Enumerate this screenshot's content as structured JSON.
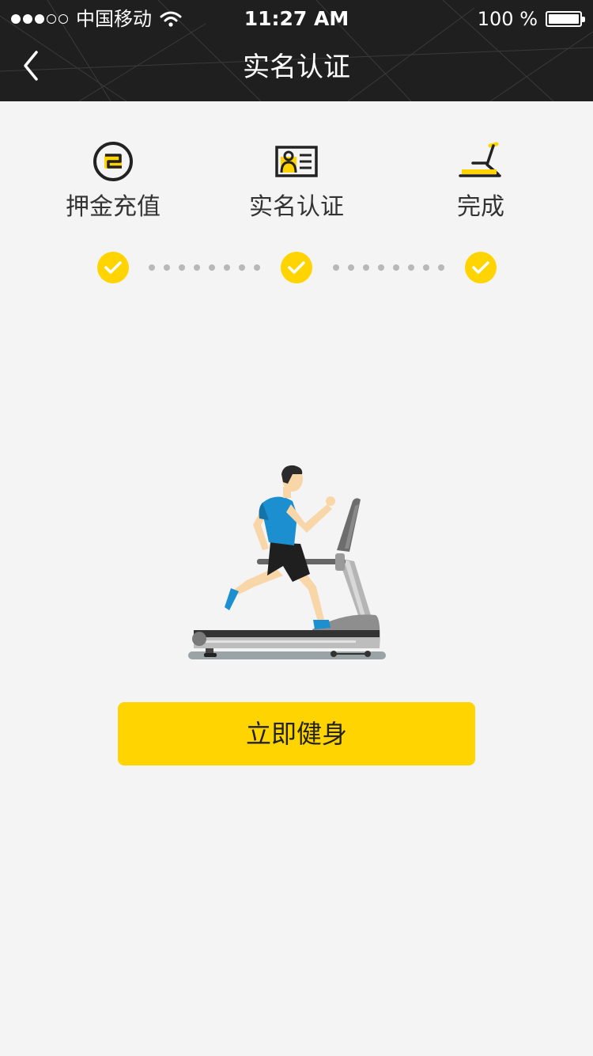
{
  "status_bar": {
    "carrier": "中国移动",
    "time": "11:27 AM",
    "battery": "100 %"
  },
  "nav": {
    "title": "实名认证"
  },
  "steps": [
    {
      "label": "押金充值",
      "icon": "deposit-icon"
    },
    {
      "label": "实名认证",
      "icon": "id-card-icon"
    },
    {
      "label": "完成",
      "icon": "treadmill-icon"
    }
  ],
  "progress": {
    "completed_steps": 3,
    "total_steps": 3
  },
  "illustration": "runner-on-treadmill",
  "cta": {
    "label": "立即健身"
  },
  "colors": {
    "accent": "#ffd400",
    "header": "#1f1f1f",
    "background": "#f4f4f4"
  }
}
